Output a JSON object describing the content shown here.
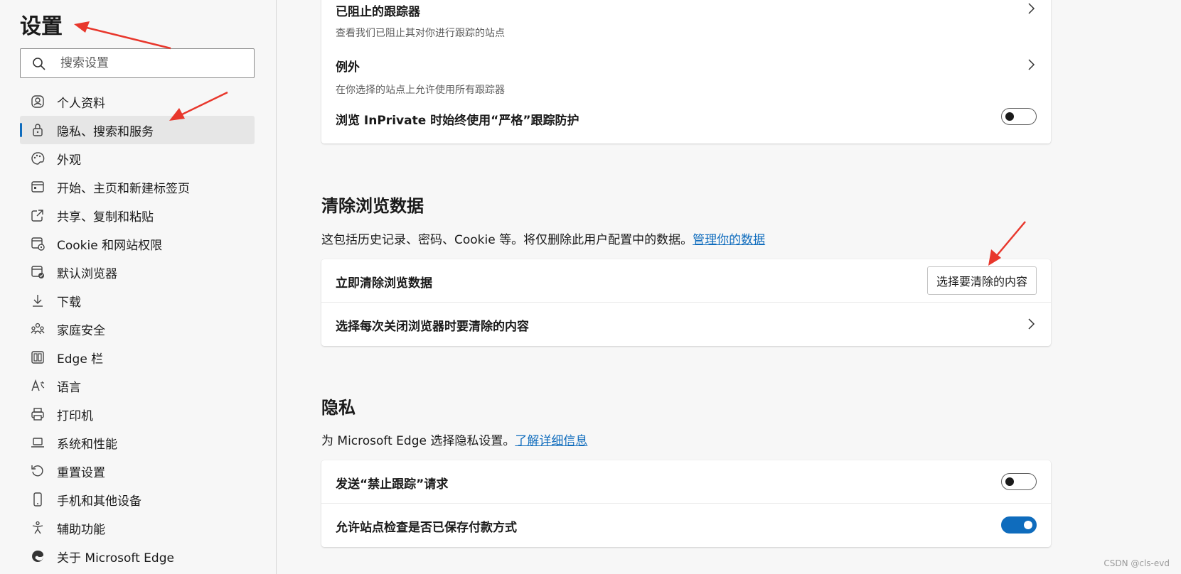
{
  "sidebar": {
    "title": "设置",
    "search_placeholder": "搜索设置",
    "items": [
      {
        "label": "个人资料",
        "icon": "profile-icon"
      },
      {
        "label": "隐私、搜索和服务",
        "icon": "lock-icon",
        "active": true
      },
      {
        "label": "外观",
        "icon": "palette-icon"
      },
      {
        "label": "开始、主页和新建标签页",
        "icon": "home-page-icon"
      },
      {
        "label": "共享、复制和粘贴",
        "icon": "share-icon"
      },
      {
        "label": "Cookie 和网站权限",
        "icon": "site-permissions-icon"
      },
      {
        "label": "默认浏览器",
        "icon": "default-browser-icon"
      },
      {
        "label": "下载",
        "icon": "download-icon"
      },
      {
        "label": "家庭安全",
        "icon": "family-icon"
      },
      {
        "label": "Edge 栏",
        "icon": "edge-bar-icon"
      },
      {
        "label": "语言",
        "icon": "language-icon"
      },
      {
        "label": "打印机",
        "icon": "printer-icon"
      },
      {
        "label": "系统和性能",
        "icon": "laptop-icon"
      },
      {
        "label": "重置设置",
        "icon": "reset-icon"
      },
      {
        "label": "手机和其他设备",
        "icon": "phone-icon"
      },
      {
        "label": "辅助功能",
        "icon": "accessibility-icon"
      },
      {
        "label": "关于 Microsoft Edge",
        "icon": "edge-logo-icon"
      }
    ]
  },
  "tracking_card": {
    "blocked_title": "已阻止的跟踪器",
    "blocked_sub": "查看我们已阻止其对你进行跟踪的站点",
    "exceptions_title": "例外",
    "exceptions_sub": "在你选择的站点上允许使用所有跟踪器",
    "inprivate_title": "浏览 InPrivate 时始终使用“严格”跟踪防护",
    "inprivate_on": false
  },
  "clear_data": {
    "heading": "清除浏览数据",
    "desc": "这包括历史记录、密码、Cookie 等。将仅删除此用户配置中的数据。",
    "desc_link": "管理你的数据",
    "now_title": "立即清除浏览数据",
    "now_button": "选择要清除的内容",
    "onclose_title": "选择每次关闭浏览器时要清除的内容"
  },
  "privacy": {
    "heading": "隐私",
    "desc": "为 Microsoft Edge 选择隐私设置。",
    "desc_link": "了解详细信息",
    "dnt_title": "发送“禁止跟踪”请求",
    "dnt_on": false,
    "payment_title": "允许站点检查是否已保存付款方式",
    "payment_on": true
  },
  "watermark": "CSDN @cls-evd",
  "colors": {
    "accent": "#0f6cbd",
    "arrow": "#e8372c"
  }
}
